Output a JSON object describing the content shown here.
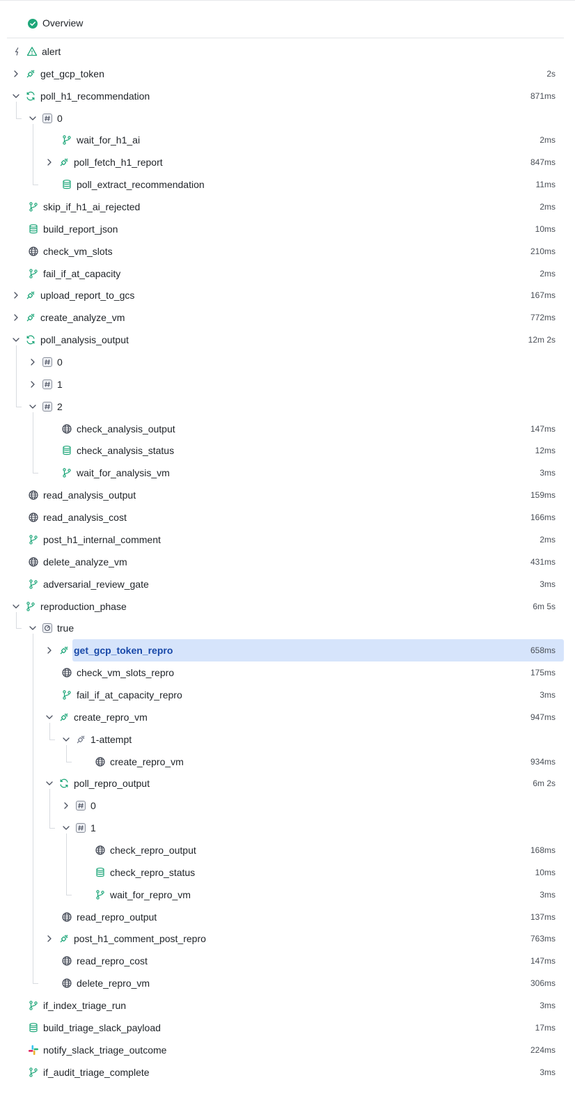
{
  "overview": {
    "label": "Overview"
  },
  "rows": [
    {
      "label": "alert",
      "duration": "",
      "icon": "alert-icon",
      "expander": "bolt"
    },
    {
      "label": "get_gcp_token",
      "duration": "2s",
      "icon": "plug-icon",
      "expander": "collapsed"
    },
    {
      "label": "poll_h1_recommendation",
      "duration": "871ms",
      "icon": "loop-icon",
      "expander": "expanded"
    },
    {
      "label": "0",
      "duration": "",
      "icon": "hash-icon",
      "expander": "expanded"
    },
    {
      "label": "wait_for_h1_ai",
      "duration": "2ms",
      "icon": "branch-icon",
      "expander": "none"
    },
    {
      "label": "poll_fetch_h1_report",
      "duration": "847ms",
      "icon": "plug-icon",
      "expander": "collapsed"
    },
    {
      "label": "poll_extract_recommendation",
      "duration": "11ms",
      "icon": "database-icon",
      "expander": "none"
    },
    {
      "label": "skip_if_h1_ai_rejected",
      "duration": "2ms",
      "icon": "branch-icon",
      "expander": "none"
    },
    {
      "label": "build_report_json",
      "duration": "10ms",
      "icon": "database-icon",
      "expander": "none"
    },
    {
      "label": "check_vm_slots",
      "duration": "210ms",
      "icon": "globe-icon",
      "expander": "none"
    },
    {
      "label": "fail_if_at_capacity",
      "duration": "2ms",
      "icon": "branch-icon",
      "expander": "none"
    },
    {
      "label": "upload_report_to_gcs",
      "duration": "167ms",
      "icon": "plug-icon",
      "expander": "collapsed"
    },
    {
      "label": "create_analyze_vm",
      "duration": "772ms",
      "icon": "plug-icon",
      "expander": "collapsed"
    },
    {
      "label": "poll_analysis_output",
      "duration": "12m 2s",
      "icon": "loop-icon",
      "expander": "expanded"
    },
    {
      "label": "0",
      "duration": "",
      "icon": "hash-icon",
      "expander": "collapsed"
    },
    {
      "label": "1",
      "duration": "",
      "icon": "hash-icon",
      "expander": "collapsed"
    },
    {
      "label": "2",
      "duration": "",
      "icon": "hash-icon",
      "expander": "expanded"
    },
    {
      "label": "check_analysis_output",
      "duration": "147ms",
      "icon": "globe-icon",
      "expander": "none"
    },
    {
      "label": "check_analysis_status",
      "duration": "12ms",
      "icon": "database-icon",
      "expander": "none"
    },
    {
      "label": "wait_for_analysis_vm",
      "duration": "3ms",
      "icon": "branch-icon",
      "expander": "none"
    },
    {
      "label": "read_analysis_output",
      "duration": "159ms",
      "icon": "globe-icon",
      "expander": "none"
    },
    {
      "label": "read_analysis_cost",
      "duration": "166ms",
      "icon": "globe-icon",
      "expander": "none"
    },
    {
      "label": "post_h1_internal_comment",
      "duration": "2ms",
      "icon": "branch-icon",
      "expander": "none"
    },
    {
      "label": "delete_analyze_vm",
      "duration": "431ms",
      "icon": "globe-icon",
      "expander": "none"
    },
    {
      "label": "adversarial_review_gate",
      "duration": "3ms",
      "icon": "branch-icon",
      "expander": "none"
    },
    {
      "label": "reproduction_phase",
      "duration": "6m 5s",
      "icon": "branch-icon",
      "expander": "expanded"
    },
    {
      "label": "true",
      "duration": "",
      "icon": "case-icon",
      "expander": "expanded"
    },
    {
      "label": "get_gcp_token_repro",
      "duration": "658ms",
      "icon": "plug-icon",
      "expander": "collapsed"
    },
    {
      "label": "check_vm_slots_repro",
      "duration": "175ms",
      "icon": "globe-icon",
      "expander": "none"
    },
    {
      "label": "fail_if_at_capacity_repro",
      "duration": "3ms",
      "icon": "branch-icon",
      "expander": "none"
    },
    {
      "label": "create_repro_vm",
      "duration": "947ms",
      "icon": "plug-icon",
      "expander": "expanded"
    },
    {
      "label": "1-attempt",
      "duration": "",
      "icon": "plug-gray-icon",
      "expander": "expanded"
    },
    {
      "label": "create_repro_vm",
      "duration": "934ms",
      "icon": "globe-icon",
      "expander": "none"
    },
    {
      "label": "poll_repro_output",
      "duration": "6m 2s",
      "icon": "loop-icon",
      "expander": "expanded"
    },
    {
      "label": "0",
      "duration": "",
      "icon": "hash-icon",
      "expander": "collapsed"
    },
    {
      "label": "1",
      "duration": "",
      "icon": "hash-icon",
      "expander": "expanded"
    },
    {
      "label": "check_repro_output",
      "duration": "168ms",
      "icon": "globe-icon",
      "expander": "none"
    },
    {
      "label": "check_repro_status",
      "duration": "10ms",
      "icon": "database-icon",
      "expander": "none"
    },
    {
      "label": "wait_for_repro_vm",
      "duration": "3ms",
      "icon": "branch-icon",
      "expander": "none"
    },
    {
      "label": "read_repro_output",
      "duration": "137ms",
      "icon": "globe-icon",
      "expander": "none"
    },
    {
      "label": "post_h1_comment_post_repro",
      "duration": "763ms",
      "icon": "plug-icon",
      "expander": "collapsed"
    },
    {
      "label": "read_repro_cost",
      "duration": "147ms",
      "icon": "globe-icon",
      "expander": "none"
    },
    {
      "label": "delete_repro_vm",
      "duration": "306ms",
      "icon": "globe-icon",
      "expander": "none"
    },
    {
      "label": "if_index_triage_run",
      "duration": "3ms",
      "icon": "branch-icon",
      "expander": "none"
    },
    {
      "label": "build_triage_slack_payload",
      "duration": "17ms",
      "icon": "database-icon",
      "expander": "none"
    },
    {
      "label": "notify_slack_triage_outcome",
      "duration": "224ms",
      "icon": "slack-icon",
      "expander": "none"
    },
    {
      "label": "if_audit_triage_complete",
      "duration": "3ms",
      "icon": "branch-icon",
      "expander": "none"
    }
  ],
  "selected_label": "get_gcp_token_repro",
  "colors": {
    "accent": "#1fa77a",
    "selected_bg": "#d6e4fb",
    "selected_text": "#1848a8"
  }
}
